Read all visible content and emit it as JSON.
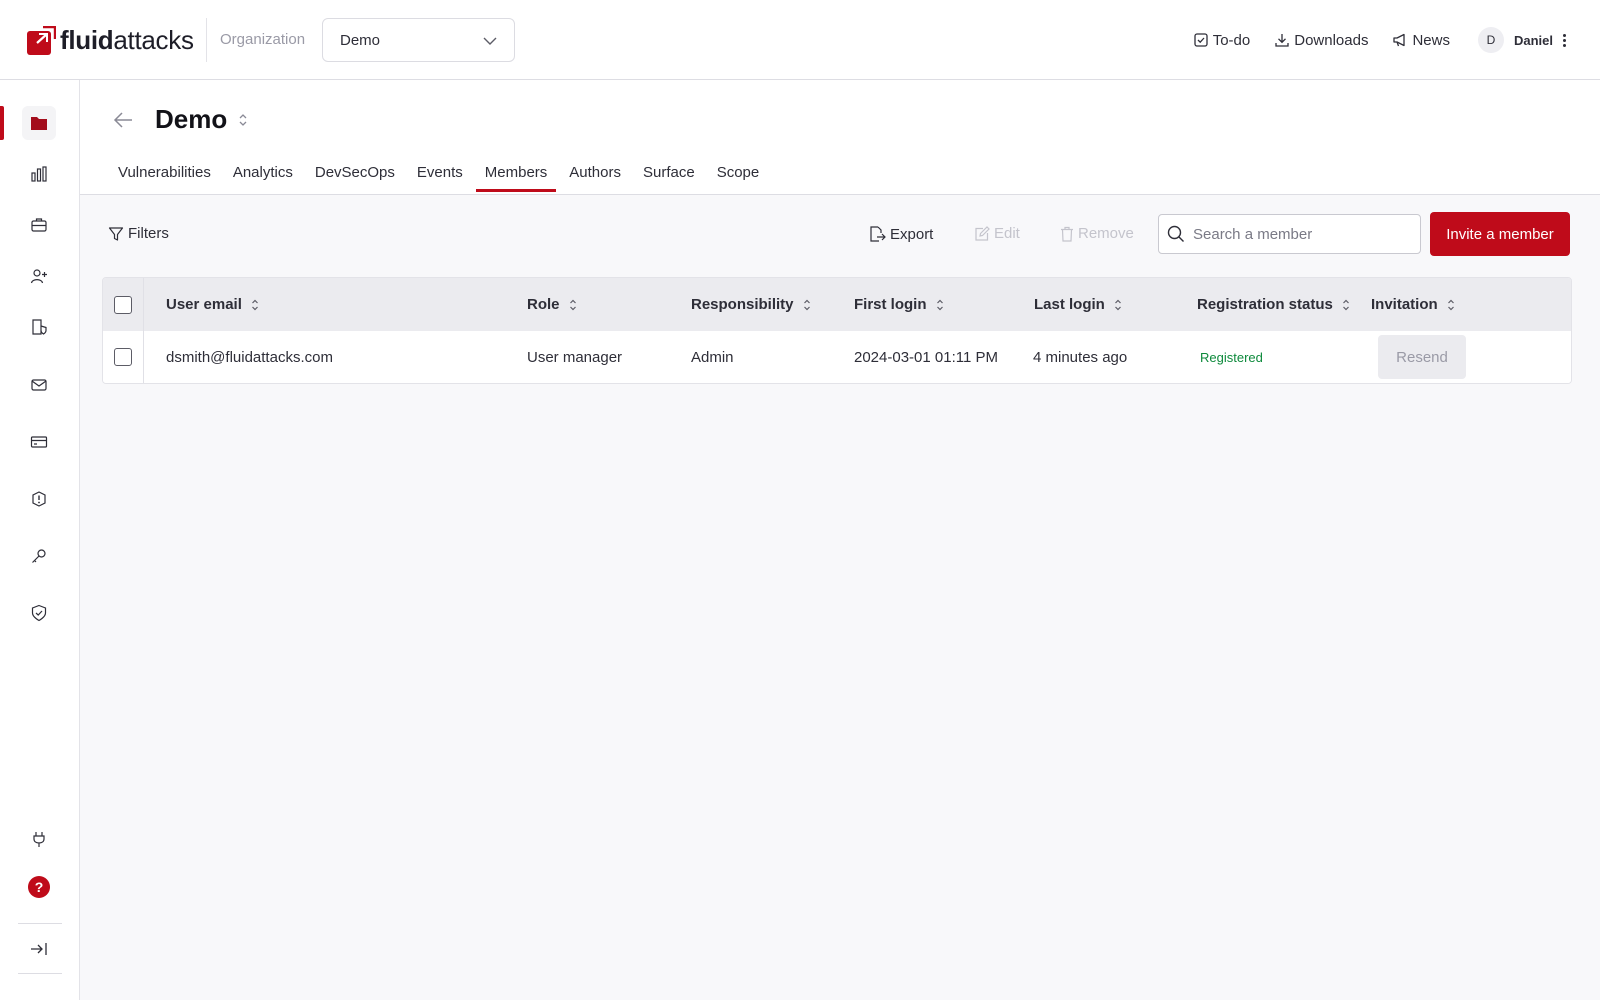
{
  "header": {
    "logo_bold": "fluid",
    "logo_light": "attacks",
    "organization_label": "Organization",
    "organization_value": "Demo",
    "nav": {
      "todo": "To-do",
      "downloads": "Downloads",
      "news": "News"
    },
    "user": {
      "initial": "D",
      "name": "Daniel"
    }
  },
  "sidebar": {
    "icons": [
      "folder-icon",
      "analytics-icon",
      "briefcase-icon",
      "add-user-icon",
      "billing-shield-icon",
      "mail-icon",
      "credit-card-icon",
      "alert-icon",
      "key-icon",
      "shield-check-icon"
    ],
    "bottom_icons": [
      "plug-icon",
      "help-icon",
      "expand-sidebar-icon"
    ],
    "help_glyph": "?"
  },
  "page": {
    "title": "Demo",
    "tabs": [
      {
        "label": "Vulnerabilities"
      },
      {
        "label": "Analytics"
      },
      {
        "label": "DevSecOps"
      },
      {
        "label": "Events"
      },
      {
        "label": "Members",
        "active": true
      },
      {
        "label": "Authors"
      },
      {
        "label": "Surface"
      },
      {
        "label": "Scope"
      }
    ]
  },
  "toolbar": {
    "filters": "Filters",
    "export": "Export",
    "edit": "Edit",
    "remove": "Remove",
    "search_placeholder": "Search a member",
    "invite": "Invite a member"
  },
  "table": {
    "columns": [
      "User email",
      "Role",
      "Responsibility",
      "First login",
      "Last login",
      "Registration status",
      "Invitation"
    ],
    "rows": [
      {
        "email": "dsmith@fluidattacks.com",
        "role": "User manager",
        "responsibility": "Admin",
        "first_login": "2024-03-01 01:11 PM",
        "last_login": "4 minutes ago",
        "registration_status": "Registered",
        "invitation": "Resend"
      }
    ]
  },
  "colors": {
    "brand": "#bf0b1a",
    "registered": "#0e8a3c"
  }
}
